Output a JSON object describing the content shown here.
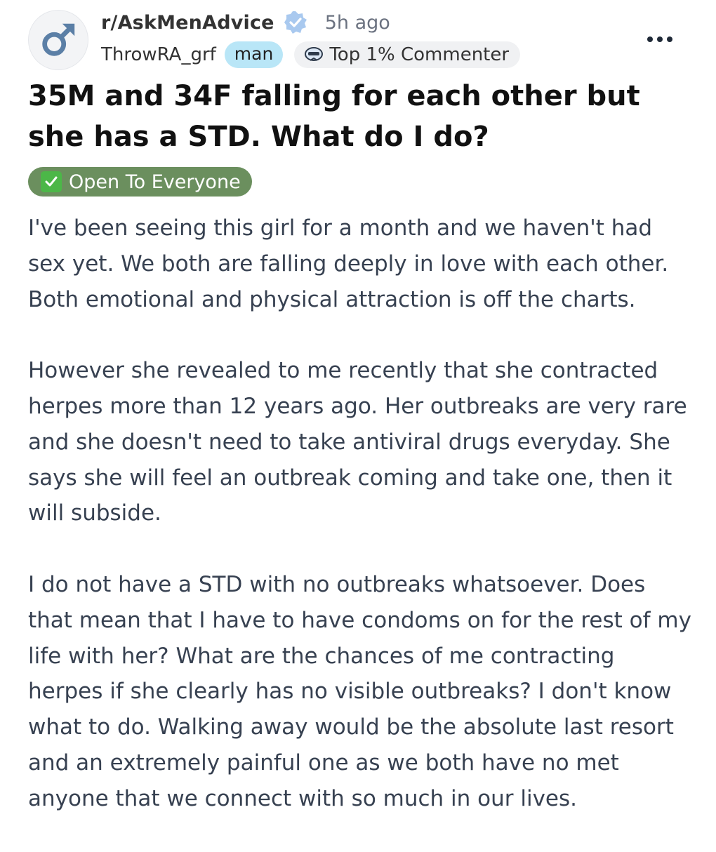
{
  "post": {
    "subreddit": "r/AskMenAdvice",
    "time_ago": "5h ago",
    "username": "ThrowRA_grf",
    "user_flair": "man",
    "badge_label": "Top 1% Commenter",
    "title": "35M and 34F falling for each other but she has a STD. What do I do?",
    "post_flair": "Open To Everyone",
    "paragraphs": [
      "I've been seeing this girl for a month and we haven't had sex yet. We both are falling deeply in love with each other. Both emotional and physical attraction is off the charts.",
      "However she revealed to me recently that she contracted herpes more than 12 years ago. Her outbreaks are very rare and she doesn't need to take antiviral drugs everyday. She says she will feel an outbreak coming and take one, then it will subside.",
      "I do not have a STD with no outbreaks whatsoever. Does that mean that I have to have condoms on for the rest of my life with her? What are the chances of me contracting herpes if she clearly has no visible outbreaks? I don't know what to do. Walking away would be the absolute last resort and an extremely painful one as we both have no met anyone that we connect with so much in our lives."
    ]
  },
  "icons": {
    "avatar": "male-symbol-icon",
    "verified": "verified-badge-icon",
    "badge": "commenter-badge-icon",
    "more": "more-options-icon",
    "flair_check": "checkmark-icon"
  },
  "colors": {
    "user_flair_bg": "#b9e6f7",
    "post_flair_bg": "#6b8f5e",
    "check_green": "#4cb748",
    "verified_blue": "#a9c9ef"
  }
}
